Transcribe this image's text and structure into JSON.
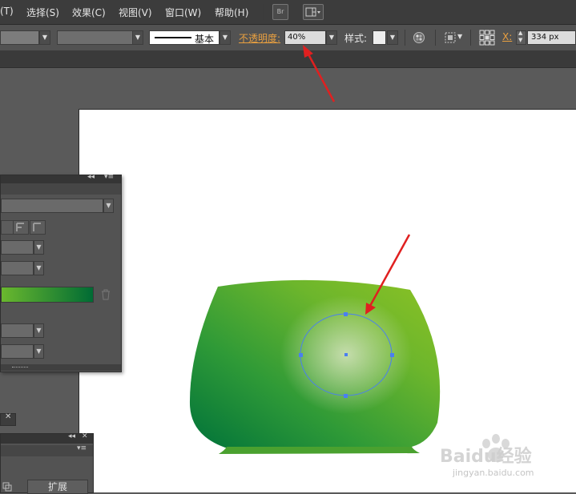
{
  "menu": {
    "items": [
      "(T)",
      "选择(S)",
      "效果(C)",
      "视图(V)",
      "窗口(W)",
      "帮助(H)"
    ],
    "bridge_icon": "Br"
  },
  "control_bar": {
    "stroke_profile": "基本",
    "opacity_label": "不透明度:",
    "opacity_value": "40%",
    "style_label": "样式:",
    "x_label": "X:",
    "x_value": "334 px"
  },
  "gradient_panel": {
    "gradient_start": "#6ab82e",
    "gradient_end": "#006b34"
  },
  "bottom_panel": {
    "expand_label": "扩展"
  },
  "artwork": {
    "vase_colors": [
      "#00723a",
      "#2f9a37",
      "#6db62c",
      "#8cc224"
    ],
    "highlight_color": "#d8e5c2",
    "selection_color": "#4a7ff0",
    "arrow_color": "#e02020"
  },
  "watermark": {
    "brand": "Baidu经验",
    "url": "jingyan.baidu.com"
  }
}
